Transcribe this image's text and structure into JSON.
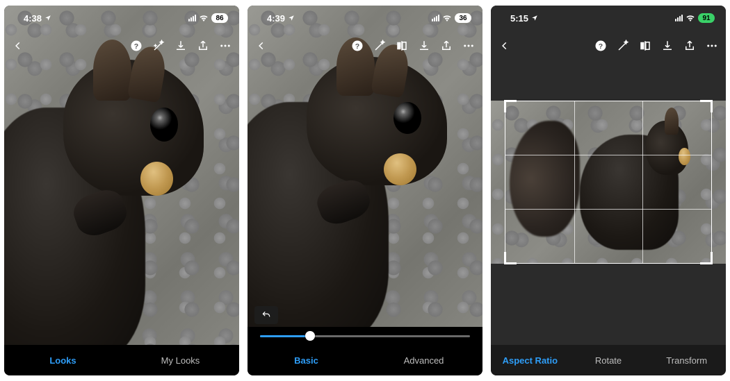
{
  "screens": [
    {
      "status": {
        "time": "4:38",
        "battery": "86",
        "battery_style": "white"
      },
      "toolbar_icons": [
        "help",
        "magic-wand",
        "download",
        "share",
        "more"
      ],
      "tabs": [
        {
          "label": "Looks",
          "active": true
        },
        {
          "label": "My Looks",
          "active": false
        }
      ]
    },
    {
      "status": {
        "time": "4:39",
        "battery": "36",
        "battery_style": "white"
      },
      "toolbar_icons": [
        "help",
        "magic-wand",
        "compare",
        "download",
        "share",
        "more"
      ],
      "slider": {
        "value": 24,
        "min": 0,
        "max": 100
      },
      "undo_visible": true,
      "tabs": [
        {
          "label": "Basic",
          "active": true
        },
        {
          "label": "Advanced",
          "active": false
        }
      ]
    },
    {
      "status": {
        "time": "5:15",
        "battery": "91",
        "battery_style": "green"
      },
      "toolbar_icons": [
        "help",
        "magic-wand",
        "compare",
        "download",
        "share",
        "more"
      ],
      "crop_grid": true,
      "tabs": [
        {
          "label": "Aspect Ratio",
          "active": true
        },
        {
          "label": "Rotate",
          "active": false
        },
        {
          "label": "Transform",
          "active": false
        }
      ]
    }
  ],
  "colors": {
    "accent": "#2e9df7"
  }
}
